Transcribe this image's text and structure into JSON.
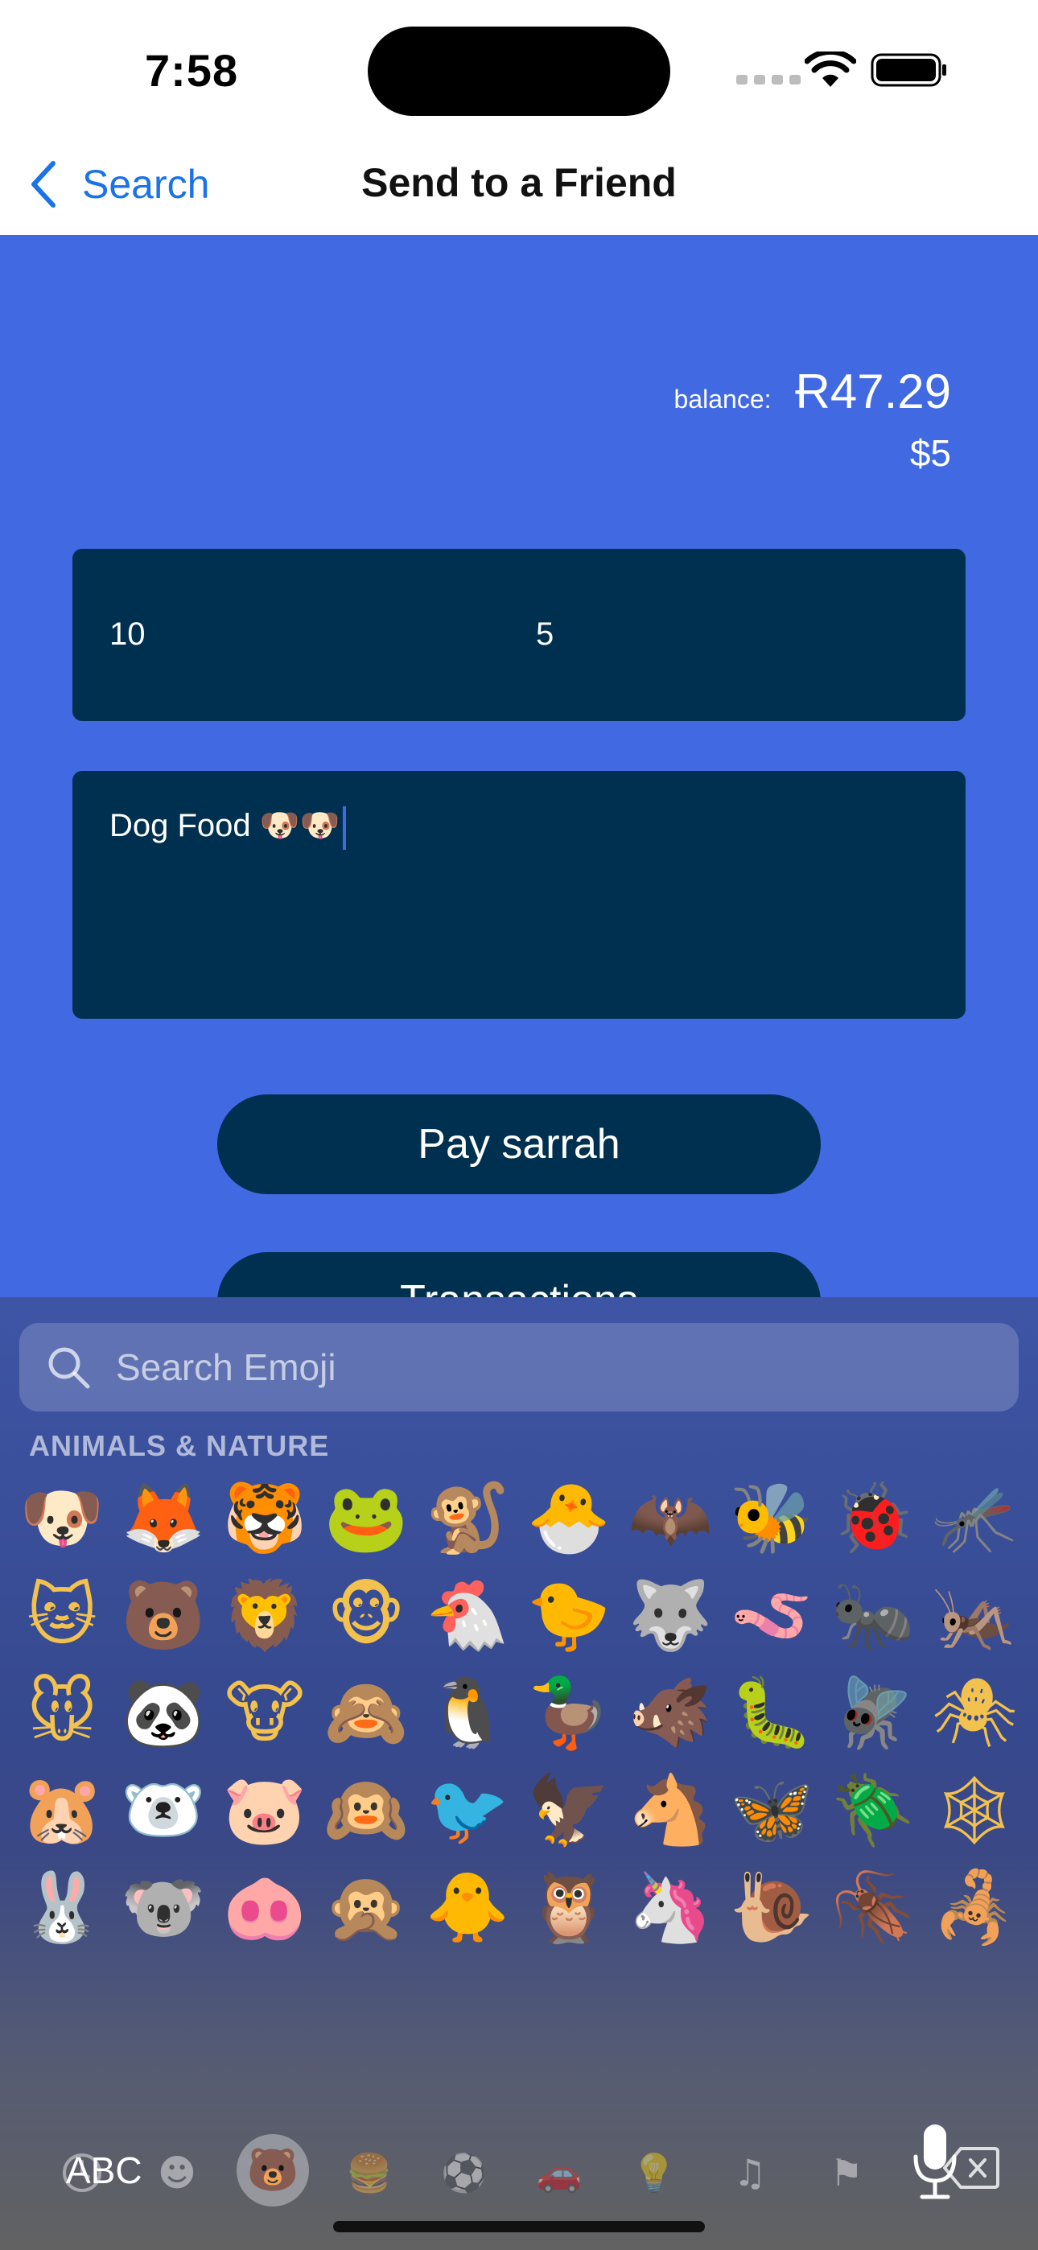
{
  "status": {
    "time": "7:58"
  },
  "nav": {
    "back_label": "Search",
    "title": "Send to a Friend"
  },
  "balance": {
    "label": "balance:",
    "value": "Ɍ47.29",
    "usd": "$5"
  },
  "amount": {
    "left_value": "10",
    "right_value": "5"
  },
  "memo": {
    "value": "Dog Food 🐶🐶"
  },
  "buttons": {
    "pay_label": "Pay sarrah",
    "transactions_label": "Transactions"
  },
  "keyboard": {
    "search_placeholder": "Search Emoji",
    "category_title": "ANIMALS & NATURE",
    "emojis": [
      "🐶",
      "🦊",
      "🐯",
      "🐸",
      "🐒",
      "🐣",
      "🦇",
      "🐝",
      "🐞",
      "🦟",
      "🐱",
      "🐻",
      "🦁",
      "🐵",
      "🐔",
      "🐤",
      "🐺",
      "🪱",
      "🐜",
      "🦗",
      "🐭",
      "🐼",
      "🐮",
      "🙈",
      "🐧",
      "🦆",
      "🐗",
      "🐛",
      "🪰",
      "🕷",
      "🐹",
      "🐻‍❄️",
      "🐷",
      "🙉",
      "🐦",
      "🦅",
      "🐴",
      "🦋",
      "🪲",
      "🕸",
      "🐰",
      "🐨",
      "🐽",
      "🙊",
      "🐥",
      "🦉",
      "🦄",
      "🐌",
      "🪳",
      "🦂"
    ],
    "categories": [
      "recent-icon",
      "smileys-icon",
      "animals-icon",
      "food-icon",
      "activity-icon",
      "travel-icon",
      "objects-icon",
      "symbols-icon",
      "flags-icon"
    ],
    "abc_label": "ABC"
  },
  "colors": {
    "accent_blue": "#4169e1",
    "field_navy": "#00304f",
    "link_blue": "#1a73e8"
  }
}
